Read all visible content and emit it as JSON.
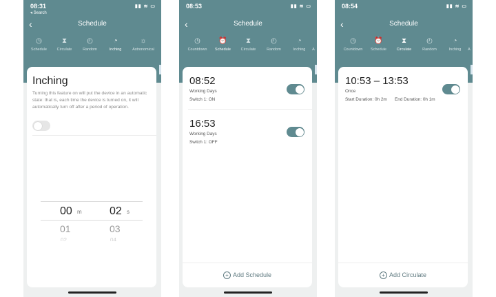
{
  "phone1": {
    "status": {
      "time": "08:31",
      "back_to": "◂ Search"
    },
    "nav_title": "Schedule",
    "tabs": [
      "Schedule",
      "Circulate",
      "Random",
      "Inching",
      "Astronomical"
    ],
    "active_tab": "Inching",
    "title": "Inching",
    "description": "Turning this feature on will put the device in an automatic state: that is, each time the device is turned on, it will automatically turn off after a period of operation.",
    "toggle_on": false,
    "picker": {
      "minutes_value": "00",
      "minutes_unit": "m",
      "seconds_value": "02",
      "seconds_unit": "s",
      "minutes_next": "01",
      "seconds_next": "03",
      "minutes_far": "02",
      "seconds_far": "04"
    }
  },
  "phone2": {
    "status": {
      "time": "08:53"
    },
    "nav_title": "Schedule",
    "tabs": [
      "Countdown",
      "Schedule",
      "Circulate",
      "Random",
      "Inching",
      "A"
    ],
    "active_tab": "Schedule",
    "schedules": [
      {
        "time": "08:52",
        "days": "Working Days",
        "action": "Switch 1: ON",
        "enabled": true
      },
      {
        "time": "16:53",
        "days": "Working Days",
        "action": "Switch 1: OFF",
        "enabled": true
      }
    ],
    "add_label": "Add Schedule"
  },
  "phone3": {
    "status": {
      "time": "08:54"
    },
    "nav_title": "Schedule",
    "tabs": [
      "Countdown",
      "Schedule",
      "Circulate",
      "Random",
      "Inching",
      "A"
    ],
    "active_tab": "Circulate",
    "circulate": {
      "time_range": "10:53 – 13:53",
      "repeat": "Once",
      "start_duration": "Start Duration: 0h 2m",
      "end_duration": "End Duration: 0h 1m",
      "enabled": true
    },
    "add_label": "Add Circulate"
  },
  "colors": {
    "header": "#5f8a90",
    "accent": "#5f8a90",
    "card": "#ffffff"
  }
}
